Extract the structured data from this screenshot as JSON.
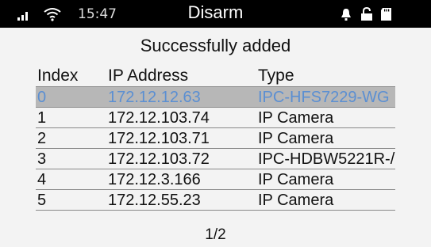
{
  "status_bar": {
    "time": "15:47",
    "title": "Disarm",
    "icons": [
      "signal-icon",
      "wifi-icon",
      "bell-icon",
      "unlock-icon",
      "sd-card-icon"
    ]
  },
  "heading": "Successfully added",
  "table": {
    "headers": [
      "Index",
      "IP Address",
      "Type"
    ],
    "rows": [
      {
        "index": "0",
        "ip": "172.12.12.63",
        "type": "IPC-HFS7229-WG",
        "selected": true
      },
      {
        "index": "1",
        "ip": "172.12.103.74",
        "type": "IP Camera",
        "selected": false
      },
      {
        "index": "2",
        "ip": "172.12.103.71",
        "type": "IP Camera",
        "selected": false
      },
      {
        "index": "3",
        "ip": "172.12.103.72",
        "type": "IPC-HDBW5221R-/",
        "selected": false
      },
      {
        "index": "4",
        "ip": "172.12.3.166",
        "type": "IP Camera",
        "selected": false
      },
      {
        "index": "5",
        "ip": "172.12.55.23",
        "type": "IP Camera",
        "selected": false
      }
    ]
  },
  "pager": "1/2",
  "colors": {
    "status_bar_bg": "#000000",
    "page_bg": "#f3f3f3",
    "selected_row_bg": "#b7b7b7",
    "selected_row_text": "#5b8fd2"
  }
}
